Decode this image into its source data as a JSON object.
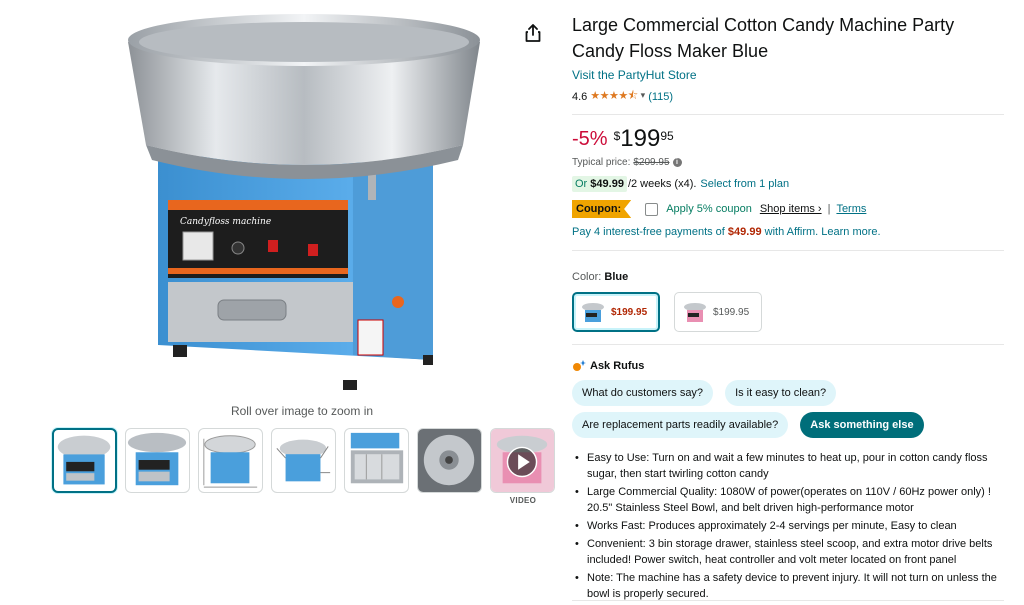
{
  "product": {
    "title": "Large Commercial Cotton Candy Machine Party Candy Floss Maker Blue",
    "store_link": "Visit the PartyHut Store",
    "rating": "4.6",
    "rating_count": "(115)"
  },
  "price": {
    "discount": "-5%",
    "currency": "$",
    "whole": "199",
    "fraction": "95",
    "typical_label": "Typical price:",
    "typical_value": "$209.95"
  },
  "installment": {
    "prefix": "Or",
    "amount": "$49.99",
    "suffix": "/2 weeks (x4).",
    "link": "Select from 1 plan"
  },
  "coupon": {
    "label": "Coupon:",
    "apply_text": "Apply 5% coupon",
    "shop_link": "Shop items ›",
    "separator": "|",
    "terms_link": "Terms"
  },
  "affirm": {
    "pre": "Pay 4 interest-free payments of",
    "amount": "$49.99",
    "post": "with Affirm. Learn more."
  },
  "color": {
    "label": "Color:",
    "value": "Blue",
    "options": [
      {
        "name": "Blue",
        "price": "$199.95"
      },
      {
        "name": "Pink",
        "price": "$199.95"
      }
    ]
  },
  "rufus": {
    "title": "Ask Rufus",
    "chips": [
      "What do customers say?",
      "Is it easy to clean?",
      "Are replacement parts readily available?",
      "Ask something else"
    ]
  },
  "bullets": [
    "Easy to Use: Turn on and wait a few minutes to heat up, pour in cotton candy floss sugar, then start twirling cotton candy",
    "Large Commercial Quality: 1080W of power(operates on 110V / 60Hz power only) ! 20.5\" Stainless Steel Bowl, and belt driven high-performance motor",
    "Works Fast: Produces approximately 2-4 servings per minute, Easy to clean",
    "Convenient: 3 bin storage drawer, stainless steel scoop, and extra motor drive belts included! Power switch, heat controller and volt meter located on front panel",
    "Note: The machine has a safety device to prevent injury. It will not turn on unless the bowl is properly secured."
  ],
  "gallery": {
    "zoom_hint": "Roll over image to zoom in",
    "video_label": "VIDEO",
    "machine_panel_text": "Candyfloss machine"
  },
  "colors": {
    "link": "#007185",
    "deal_red": "#cc0c39",
    "price_red": "#b12704",
    "coupon_orange": "#f0a400",
    "star_orange": "#de7921",
    "machine_blue": "#4a9fdc"
  }
}
